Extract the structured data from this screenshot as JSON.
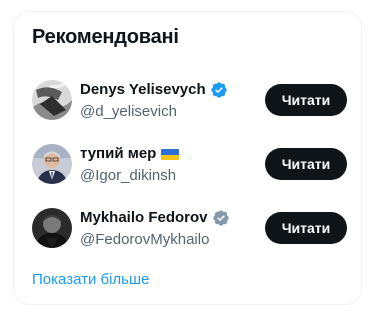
{
  "panel": {
    "title": "Рекомендовані",
    "show_more": "Показати більше"
  },
  "colors": {
    "accent": "#1d9bf0",
    "verified_blue": "#1d9bf0",
    "verified_gray": "#829aab",
    "button_bg": "#0f1419"
  },
  "users": [
    {
      "name": "Denys Yelisevych",
      "handle": "@d_yelisevich",
      "badge": "verified-blue-icon",
      "follow_label": "Читати"
    },
    {
      "name": "тупий мер",
      "handle": "@Igor_dikinsh",
      "badge": "ukraine-flag-icon",
      "follow_label": "Читати"
    },
    {
      "name": "Mykhailo Fedorov",
      "handle": "@FedorovMykhailo",
      "badge": "verified-gray-icon",
      "follow_label": "Читати"
    }
  ]
}
